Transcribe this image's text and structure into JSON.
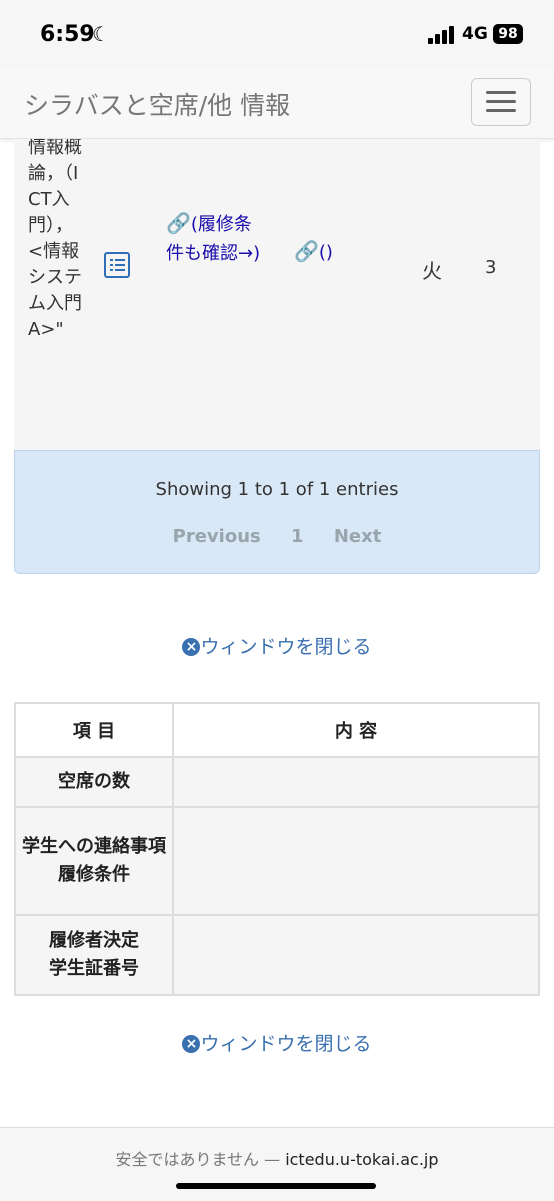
{
  "status_bar": {
    "time": "6:59",
    "network": "4G",
    "battery": "98"
  },
  "header": {
    "title": "シラバスと空席/他 情報"
  },
  "course_row": {
    "name": "情報概論，（ICT入門），<情報システム入門A>\"",
    "link1_text": "(履修条件も確認→)",
    "link2_text": "()",
    "day": "火",
    "period": "3"
  },
  "pagination": {
    "info": "Showing 1 to 1 of 1 entries",
    "previous": "Previous",
    "page": "1",
    "next": "Next"
  },
  "close_window": "ウィンドウを閉じる",
  "detail_table": {
    "headers": [
      "項 目",
      "内 容"
    ],
    "rows": [
      {
        "label": "空席の数"
      },
      {
        "label_line1": "学生への連絡事項",
        "label_line2": "履修条件"
      },
      {
        "label_line1": "履修者決定",
        "label_line2": "学生証番号"
      }
    ]
  },
  "url_bar": {
    "prefix": "安全ではありません — ",
    "domain": "ictedu.u-tokai.ac.jp"
  }
}
